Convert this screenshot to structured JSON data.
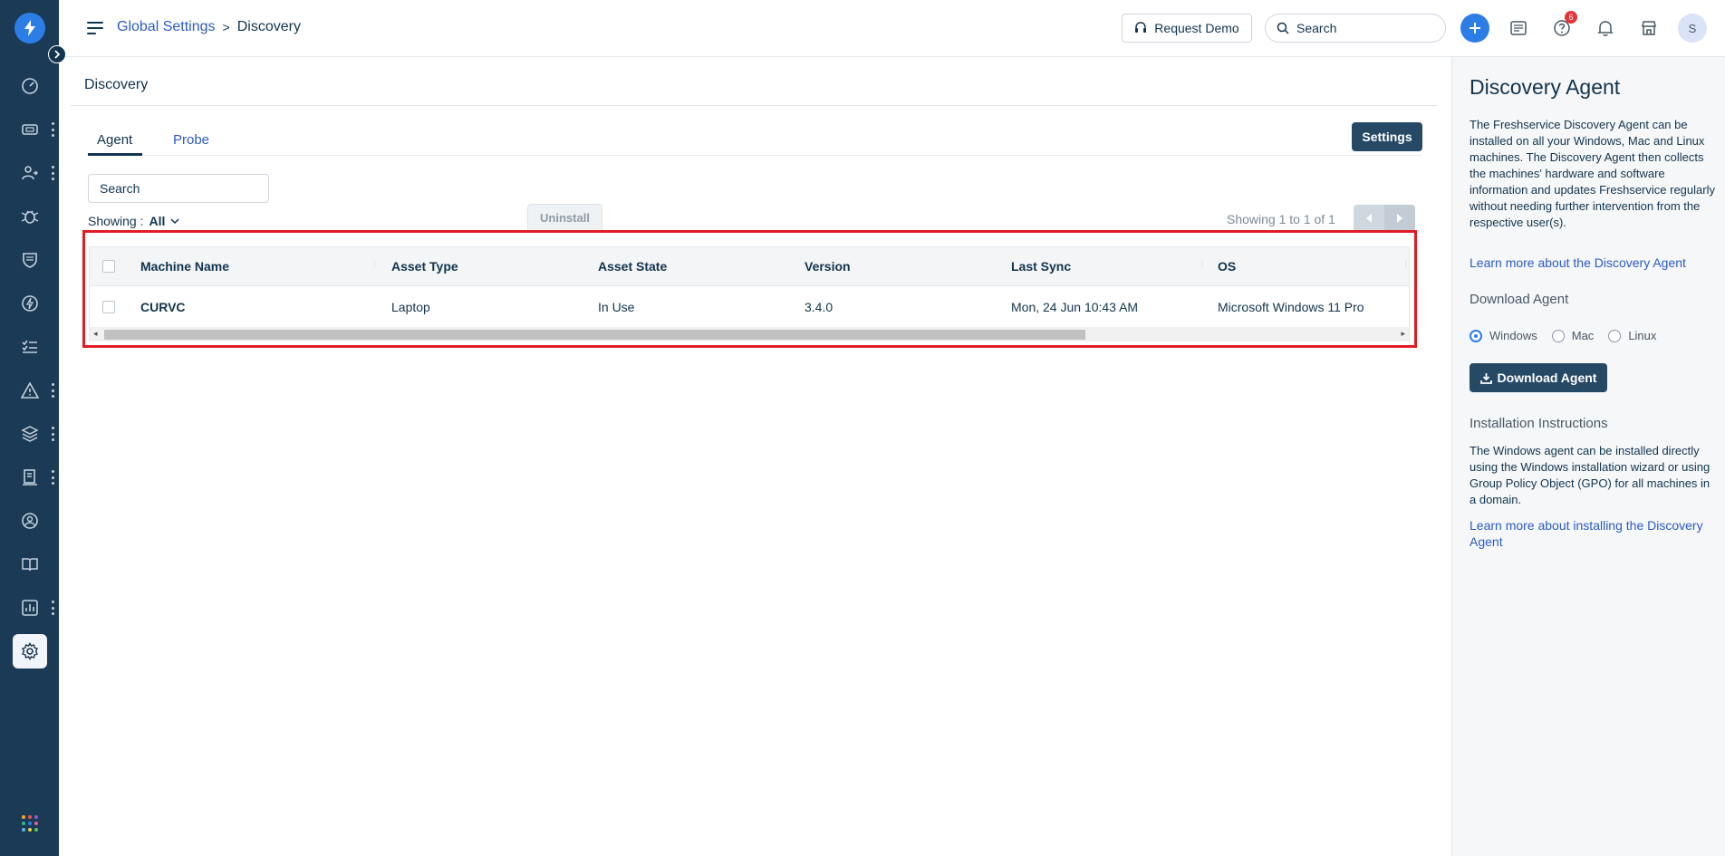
{
  "header": {
    "breadcrumb_parent": "Global Settings",
    "breadcrumb_separator": ">",
    "breadcrumb_current": "Discovery",
    "request_demo_label": "Request Demo",
    "search_placeholder": "Search",
    "help_badge_count": "6",
    "avatar_initial": "S"
  },
  "nav": {
    "icons": [
      "dashboard-icon",
      "tickets-icon",
      "changes-icon",
      "problems-icon",
      "shield-icon",
      "releases-icon",
      "tasks-icon",
      "alerts-icon",
      "assets-icon",
      "contracts-icon",
      "people-icon",
      "solutions-icon",
      "reports-icon",
      "admin-settings-icon"
    ],
    "active": "admin-settings-icon"
  },
  "main": {
    "title": "Discovery",
    "tabs": [
      {
        "label": "Agent",
        "active": true
      },
      {
        "label": "Probe",
        "active": false
      }
    ],
    "settings_label": "Settings",
    "search_placeholder": "Search",
    "showing_label": "Showing :",
    "showing_value": "All",
    "uninstall_label": "Uninstall",
    "pagination_text": "Showing 1 to 1 of 1"
  },
  "table": {
    "columns": [
      "Machine Name",
      "Asset Type",
      "Asset State",
      "Version",
      "Last Sync",
      "OS"
    ],
    "rows": [
      {
        "machine_name": "CURVC",
        "asset_type": "Laptop",
        "asset_state": "In Use",
        "version": "3.4.0",
        "last_sync": "Mon, 24 Jun 10:43 AM",
        "os": "Microsoft Windows 11 Pro"
      }
    ]
  },
  "panel": {
    "title": "Discovery Agent",
    "description": "The Freshservice Discovery Agent can be installed on all your Windows, Mac and Linux machines. The Discovery Agent then collects the machines' hardware and software information and updates Freshservice regularly without needing further intervention from the respective user(s).",
    "learn_more_link": "Learn more about the Discovery Agent",
    "download_heading": "Download Agent",
    "os_options": [
      "Windows",
      "Mac",
      "Linux"
    ],
    "os_selected": "Windows",
    "download_button": "Download Agent",
    "install_heading": "Installation Instructions",
    "install_text": "The Windows agent can be installed directly using the Windows installation wizard or using Group Policy Object (GPO) for all machines in a domain.",
    "install_link": "Learn more about installing the Discovery Agent"
  },
  "colors": {
    "nav_bg": "#1b3a55",
    "primary_button": "#264966",
    "link": "#2c5cc5",
    "accent": "#2c7ee6",
    "highlight_border": "#e31c24"
  }
}
